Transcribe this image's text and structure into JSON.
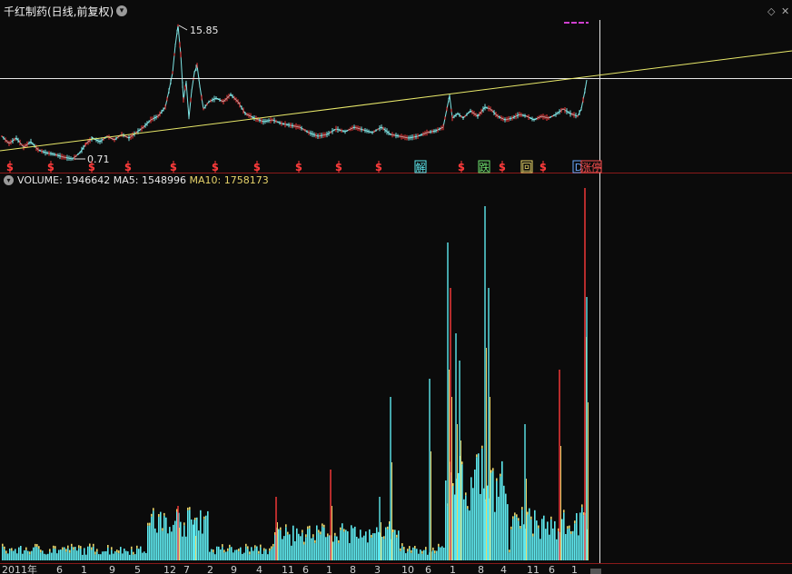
{
  "header": {
    "title": "千红制药(日线,前复权)",
    "dropdown_icon": "chevron-down-icon",
    "window_icons": [
      "diamond-icon",
      "close-icon"
    ]
  },
  "price_panel": {
    "high_label": "15.85",
    "low_label": "0.71",
    "markers": [
      {
        "label": "S",
        "kind": "s"
      },
      {
        "label": "S",
        "kind": "s"
      },
      {
        "label": "S",
        "kind": "s"
      },
      {
        "label": "S",
        "kind": "s"
      },
      {
        "label": "S",
        "kind": "s"
      },
      {
        "label": "S",
        "kind": "s"
      },
      {
        "label": "S",
        "kind": "s"
      },
      {
        "label": "S",
        "kind": "s"
      },
      {
        "label": "S",
        "kind": "s"
      },
      {
        "label": "S",
        "kind": "s"
      },
      {
        "label": "解",
        "kind": "box-cyan"
      },
      {
        "label": "S",
        "kind": "s"
      },
      {
        "label": "跌",
        "kind": "box-green"
      },
      {
        "label": "S",
        "kind": "s"
      },
      {
        "label": "回",
        "kind": "box-yellow"
      },
      {
        "label": "S",
        "kind": "s"
      },
      {
        "label": "D",
        "kind": "box-blue"
      },
      {
        "label": "涨停",
        "kind": "box-red"
      }
    ]
  },
  "volume_panel": {
    "volume_label": "VOLUME: 1946642",
    "ma5_label": "MA5: 1548996",
    "ma10_label": "MA10: 1758173"
  },
  "axis": {
    "labels": [
      "2011年",
      "6",
      "1",
      "9",
      "5",
      "12",
      "7",
      "2",
      "9",
      "4",
      "11",
      "6",
      "1",
      "8",
      "3",
      "10",
      "6",
      "1",
      "8",
      "4",
      "11",
      "6",
      "1"
    ]
  },
  "colors": {
    "background": "#0b0b0b",
    "price_line": "#7fe6e6",
    "up": "#ff3b3b",
    "trend_line": "#e8e86a",
    "cursor_line": "#e6e6e6",
    "volume_cyan": "#5ee8ee",
    "volume_yellow": "#e8d46a",
    "divider": "#8a1a1a",
    "magenta": "#d040d0"
  }
}
